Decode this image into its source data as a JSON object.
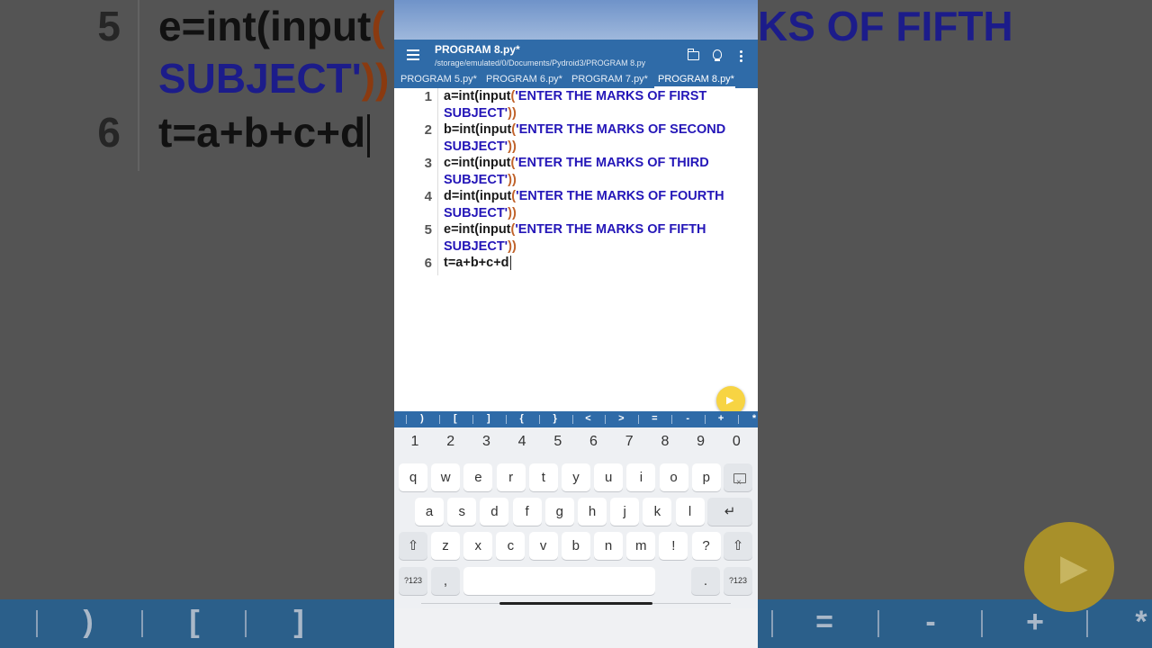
{
  "app": {
    "title": "PROGRAM 8.py*",
    "path": "/storage/emulated/0/Documents/Pydroid3/PROGRAM 8.py",
    "accent": "#2f6ba8",
    "fab_color": "#f7d443"
  },
  "tabs": [
    {
      "label": "PROGRAM 5.py*",
      "active": false
    },
    {
      "label": "PROGRAM 6.py*",
      "active": false
    },
    {
      "label": "PROGRAM 7.py*",
      "active": false
    },
    {
      "label": "PROGRAM 8.py*",
      "active": true
    }
  ],
  "editor": {
    "lines": [
      {
        "num": "1",
        "pre": "a=int(input",
        "open": "(",
        "str1": "'ENTER THE MARKS OF FIRST",
        "str2": "SUBJECT'",
        "close": "))"
      },
      {
        "num": "2",
        "pre": "b=int(input",
        "open": "(",
        "str1": "'ENTER THE MARKS OF SECOND",
        "str2": "SUBJECT'",
        "close": "))"
      },
      {
        "num": "3",
        "pre": "c=int(input",
        "open": "(",
        "str1": "'ENTER THE MARKS OF THIRD",
        "str2": "SUBJECT'",
        "close": "))"
      },
      {
        "num": "4",
        "pre": "d=int(input",
        "open": "(",
        "str1": "'ENTER THE MARKS OF FOURTH",
        "str2": "SUBJECT'",
        "close": "))"
      },
      {
        "num": "5",
        "pre": "e=int(input",
        "open": "(",
        "str1": "'ENTER THE MARKS OF FIFTH",
        "str2": "SUBJECT'",
        "close": "))"
      },
      {
        "num": "6",
        "text": "t=a+b+c+d"
      }
    ]
  },
  "symbols": [
    ")",
    "[",
    "]",
    "{",
    "}",
    "<",
    ">",
    "=",
    "-",
    "+",
    "*"
  ],
  "keyboard": {
    "numbers": [
      "1",
      "2",
      "3",
      "4",
      "5",
      "6",
      "7",
      "8",
      "9",
      "0"
    ],
    "row1": [
      "q",
      "w",
      "e",
      "r",
      "t",
      "y",
      "u",
      "i",
      "o",
      "p"
    ],
    "row2": [
      "a",
      "s",
      "d",
      "f",
      "g",
      "h",
      "j",
      "k",
      "l"
    ],
    "row3": [
      "z",
      "x",
      "c",
      "v",
      "b",
      "n",
      "m",
      "!",
      "?"
    ],
    "symbols_key": "?123",
    "comma": ",",
    "period": ".",
    "enter": "↵",
    "shift": "⇧"
  },
  "background": {
    "line5_num": "5",
    "line5_pre": "e=int(input",
    "line5_open": "(",
    "line5_str": "KS OF FIFTH",
    "line5b": "SUBJECT'",
    "line5b_close": "))",
    "line6_num": "6",
    "line6": "t=a+b+c+d",
    "bar_symbols": [
      ")",
      "[",
      "]",
      "=",
      "-",
      "+",
      "*"
    ]
  }
}
